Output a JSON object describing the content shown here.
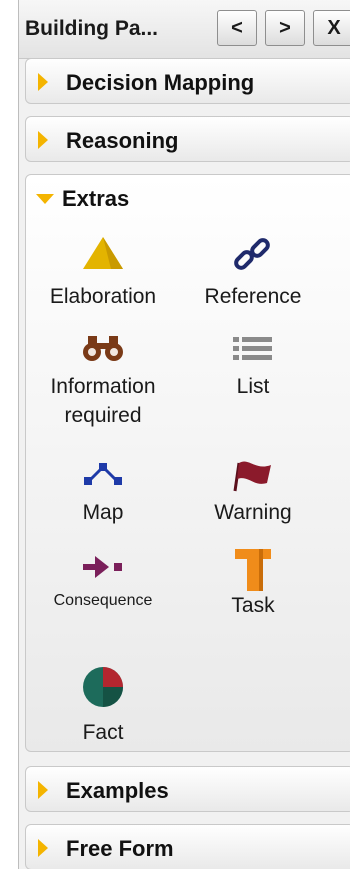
{
  "header": {
    "title": "Building Pa...",
    "prev_label": "<",
    "next_label": ">",
    "close_label": "X"
  },
  "sections": {
    "decision_mapping": "Decision Mapping",
    "reasoning": "Reasoning",
    "extras": "Extras",
    "examples": "Examples",
    "free_form": "Free Form"
  },
  "extras_items": {
    "elaboration": "Elaboration",
    "reference": "Reference",
    "information_required_1": "Information",
    "information_required_2": "required",
    "list": "List",
    "map": "Map",
    "warning": "Warning",
    "consequence": "Consequence",
    "task": "Task",
    "fact": "Fact"
  },
  "colors": {
    "arrow": "#f4b400",
    "elaboration_icon": "#e3b400",
    "reference_icon": "#1f2a6b",
    "info_icon": "#7a3a17",
    "list_icon": "#8a8a8a",
    "map_icon": "#1e3aa8",
    "warning_icon": "#8b1a2b",
    "consequence_icon": "#7a1f5a",
    "task_icon": "#f08c1a",
    "fact_icon_a": "#1d6b5b",
    "fact_icon_b": "#b3262f"
  }
}
